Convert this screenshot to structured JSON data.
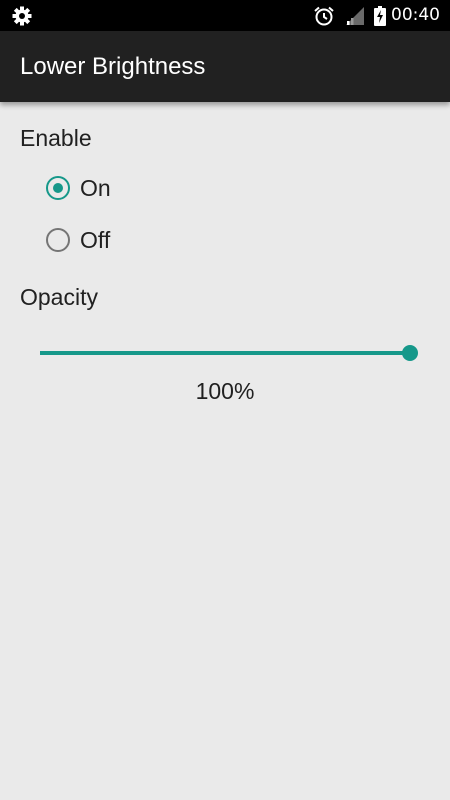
{
  "status_bar": {
    "time": "00:40",
    "icons": [
      "settings-gear-icon",
      "alarm-clock-icon",
      "cell-signal-icon",
      "battery-charging-icon"
    ]
  },
  "app_bar": {
    "title": "Lower Brightness"
  },
  "enable": {
    "label": "Enable",
    "options": [
      {
        "label": "On",
        "selected": true
      },
      {
        "label": "Off",
        "selected": false
      }
    ]
  },
  "opacity": {
    "label": "Opacity",
    "value_percent": 100,
    "value_text": "100%"
  },
  "colors": {
    "accent": "#16988a",
    "status_bar": "#000000",
    "app_bar": "#212121",
    "background": "#eaeaea",
    "text": "#212121",
    "radio_unchecked": "#757575"
  }
}
